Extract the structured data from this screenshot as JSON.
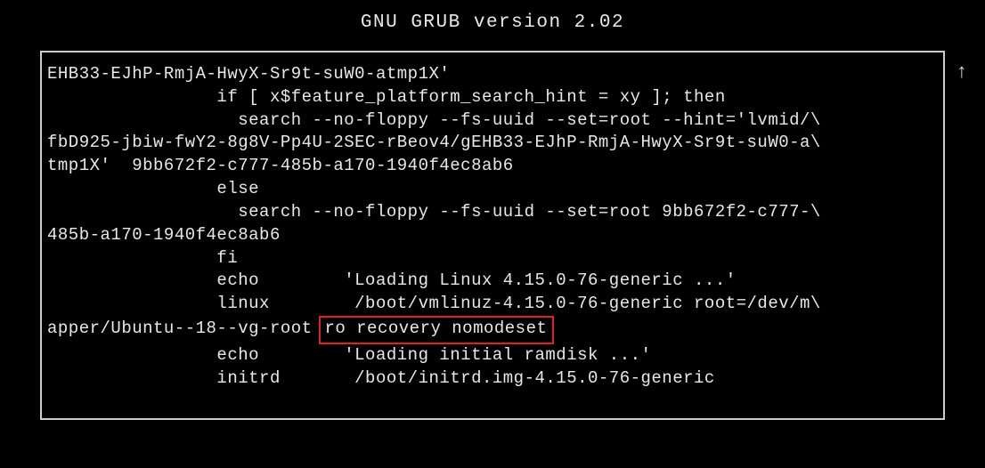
{
  "header": {
    "title": "GNU GRUB  version 2.02"
  },
  "scroll": {
    "arrow": "↑"
  },
  "grub": {
    "l01": "EHB33-EJhP-RmjA-HwyX-Sr9t-suW0-atmp1X'",
    "l02": "                if [ x$feature_platform_search_hint = xy ]; then",
    "l03": "                  search --no-floppy --fs-uuid --set=root --hint='lvmid/\\",
    "l04": "fbD925-jbiw-fwY2-8g8V-Pp4U-2SEC-rBeov4/gEHB33-EJhP-RmjA-HwyX-Sr9t-suW0-a\\",
    "l05": "tmp1X'  9bb672f2-c777-485b-a170-1940f4ec8ab6",
    "l06": "                else",
    "l07": "                  search --no-floppy --fs-uuid --set=root 9bb672f2-c777-\\",
    "l08": "485b-a170-1940f4ec8ab6",
    "l09": "                fi",
    "l10": "                echo        'Loading Linux 4.15.0-76-generic ...'",
    "l11": "                linux        /boot/vmlinuz-4.15.0-76-generic root=/dev/m\\",
    "l12_prefix": "apper/Ubuntu--18--vg-root ",
    "l12_highlight": "ro recovery nomodeset",
    "l13": "                echo        'Loading initial ramdisk ...'",
    "l14": "                initrd       /boot/initrd.img-4.15.0-76-generic"
  }
}
